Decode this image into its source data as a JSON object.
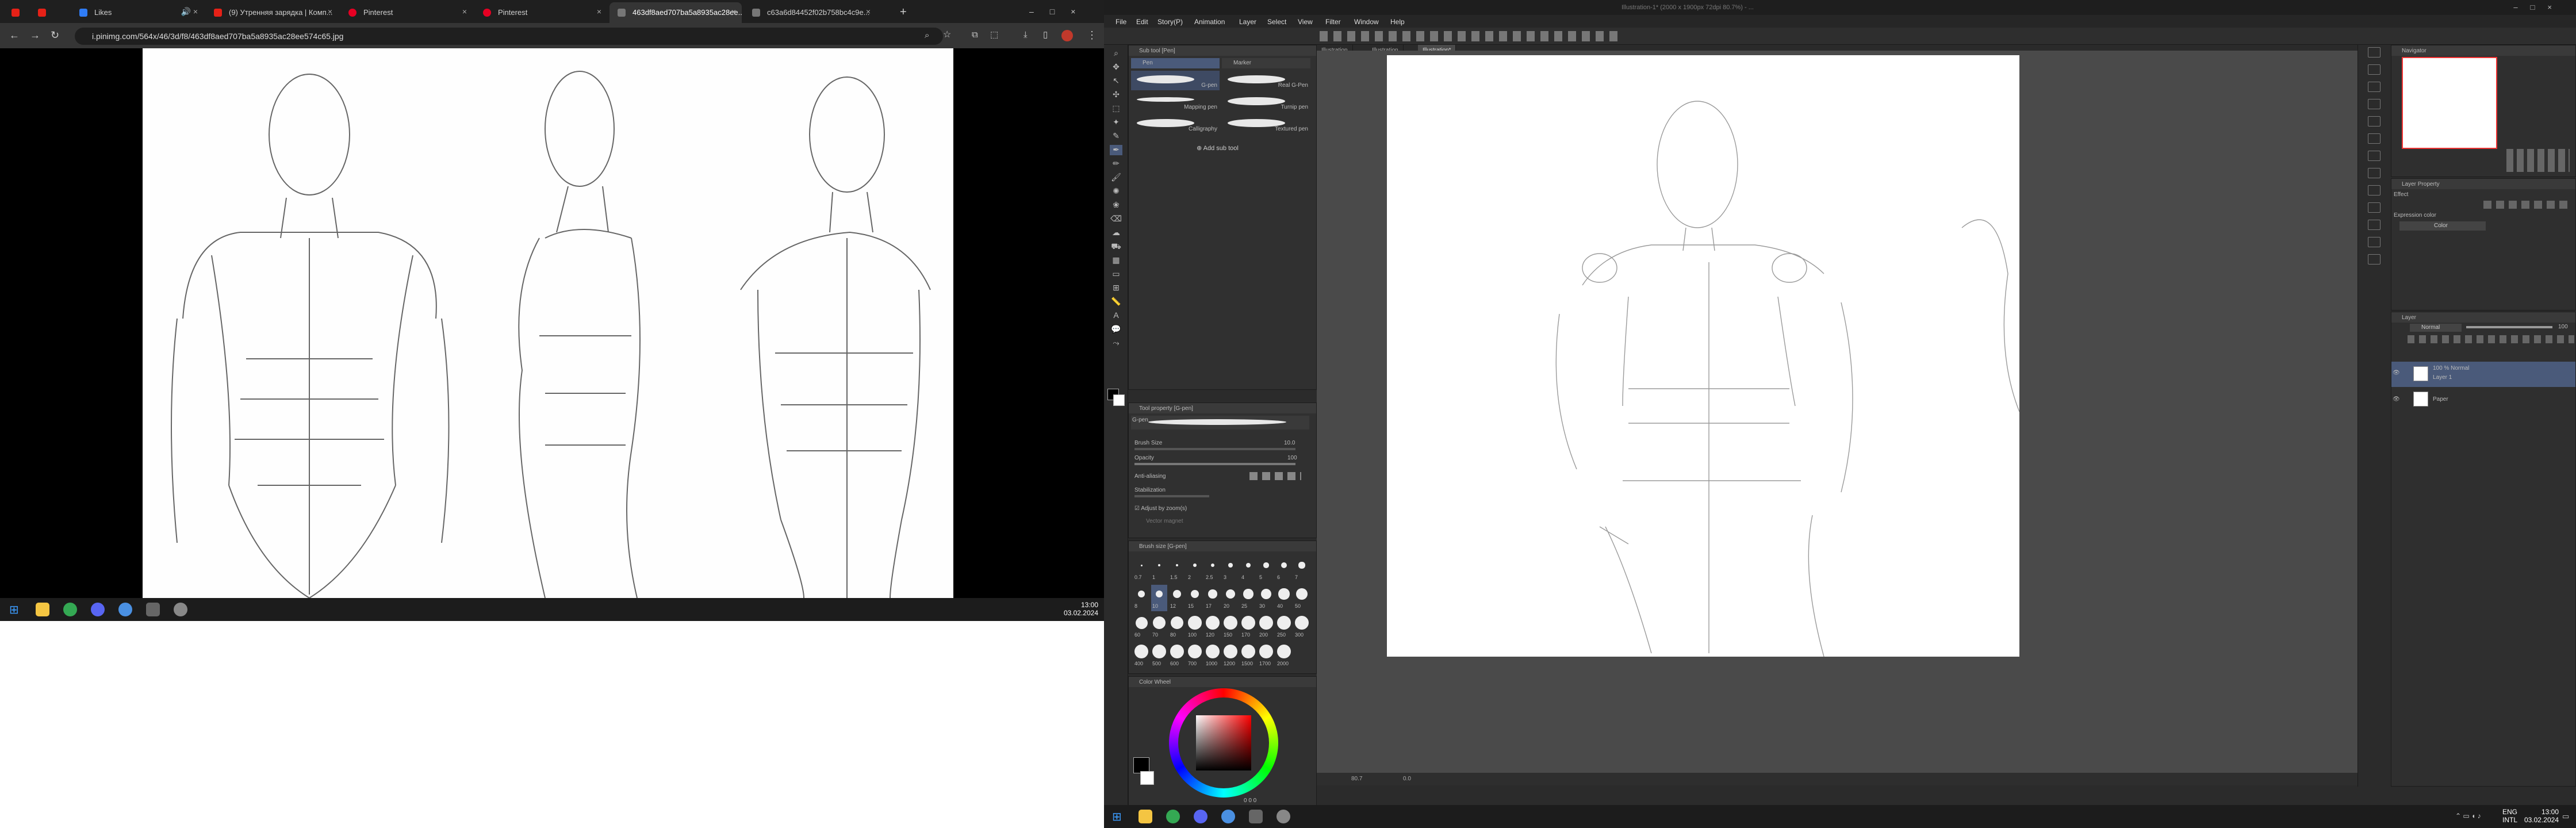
{
  "browser": {
    "tabs": [
      {
        "label": ""
      },
      {
        "label": ""
      },
      {
        "label": "Likes"
      },
      {
        "label": "(9) Утренняя зарядка | Комп..."
      },
      {
        "label": "Pinterest"
      },
      {
        "label": "Pinterest"
      },
      {
        "label": "463df8aed707ba5a8935ac28ee..."
      },
      {
        "label": "c63a6d84452f02b758bc4c9e..."
      }
    ],
    "url": "i.pinimg.com/564x/46/3d/f8/463df8aed707ba5a8935ac28ee574c65.jpg",
    "new_tab": "+",
    "nav": {
      "back": "←",
      "forward": "→",
      "reload": "↻"
    }
  },
  "taskbar_left": {
    "time": "13:00",
    "date": "03.02.2024",
    "start_glyph": "⊞"
  },
  "csp": {
    "title": "Illustration-1* (2000 x 1900px 72dpi 80.7%) - ...",
    "menu": [
      "File",
      "Edit",
      "Story(P)",
      "Animation",
      "Layer",
      "Select",
      "View",
      "Filter",
      "Window",
      "Help"
    ],
    "subtool_panel": {
      "header": "Sub tool [Pen]",
      "groups": [
        "Pen",
        "Marker"
      ],
      "brushes": [
        {
          "name": "G-pen"
        },
        {
          "name": "Real G-Pen"
        },
        {
          "name": "Mapping pen"
        },
        {
          "name": "Turnip pen"
        },
        {
          "name": "Calligraphy"
        },
        {
          "name": "Textured pen"
        }
      ],
      "add_sub_tool": "Add sub tool"
    },
    "tool_property": {
      "header": "Tool property [G-pen]",
      "current": "G-pen",
      "rows": [
        {
          "label": "Brush Size",
          "value": "10.0"
        },
        {
          "label": "Opacity",
          "value": "100"
        },
        {
          "label": "Anti-aliasing",
          "value": ""
        },
        {
          "label": "Stabilization",
          "value": ""
        }
      ],
      "adjust": "Adjust by zoom(s)",
      "vector": "Vector magnet"
    },
    "brush_size": {
      "header": "Brush size [G-pen]",
      "sizes": [
        "0.7",
        "1",
        "1.5",
        "2",
        "2.5",
        "3",
        "4",
        "5",
        "6",
        "7",
        "8",
        "10",
        "12",
        "15",
        "17",
        "20",
        "25",
        "30",
        "40",
        "50",
        "60",
        "70",
        "80",
        "100",
        "120",
        "150",
        "170",
        "200",
        "250",
        "300",
        "400",
        "500",
        "600",
        "700",
        "1000",
        "1200",
        "1500",
        "1700",
        "2000"
      ],
      "selected": "10"
    },
    "color_wheel": {
      "header": "Color Wheel",
      "readout": "0  0  0"
    },
    "doc_tabs": [
      "Illustration",
      "Illustration",
      "Illustration*"
    ],
    "status": {
      "zoom": "80.7",
      "angle": "0.0"
    },
    "navigator": {
      "header": "Navigator"
    },
    "layer_property": {
      "header": "Layer Property",
      "effect": "Effect",
      "expression_label": "Expression color",
      "expression_value": "Color"
    },
    "layers": {
      "header": "Layer",
      "blend": "Normal",
      "opacity": "100",
      "items": [
        {
          "name": "Layer 1",
          "mode": "100 % Normal"
        },
        {
          "name": "Paper",
          "mode": ""
        }
      ]
    }
  },
  "taskbar_right": {
    "lang": "ENG",
    "lang2": "INTL",
    "time": "13:00",
    "date": "03.02.2024"
  }
}
